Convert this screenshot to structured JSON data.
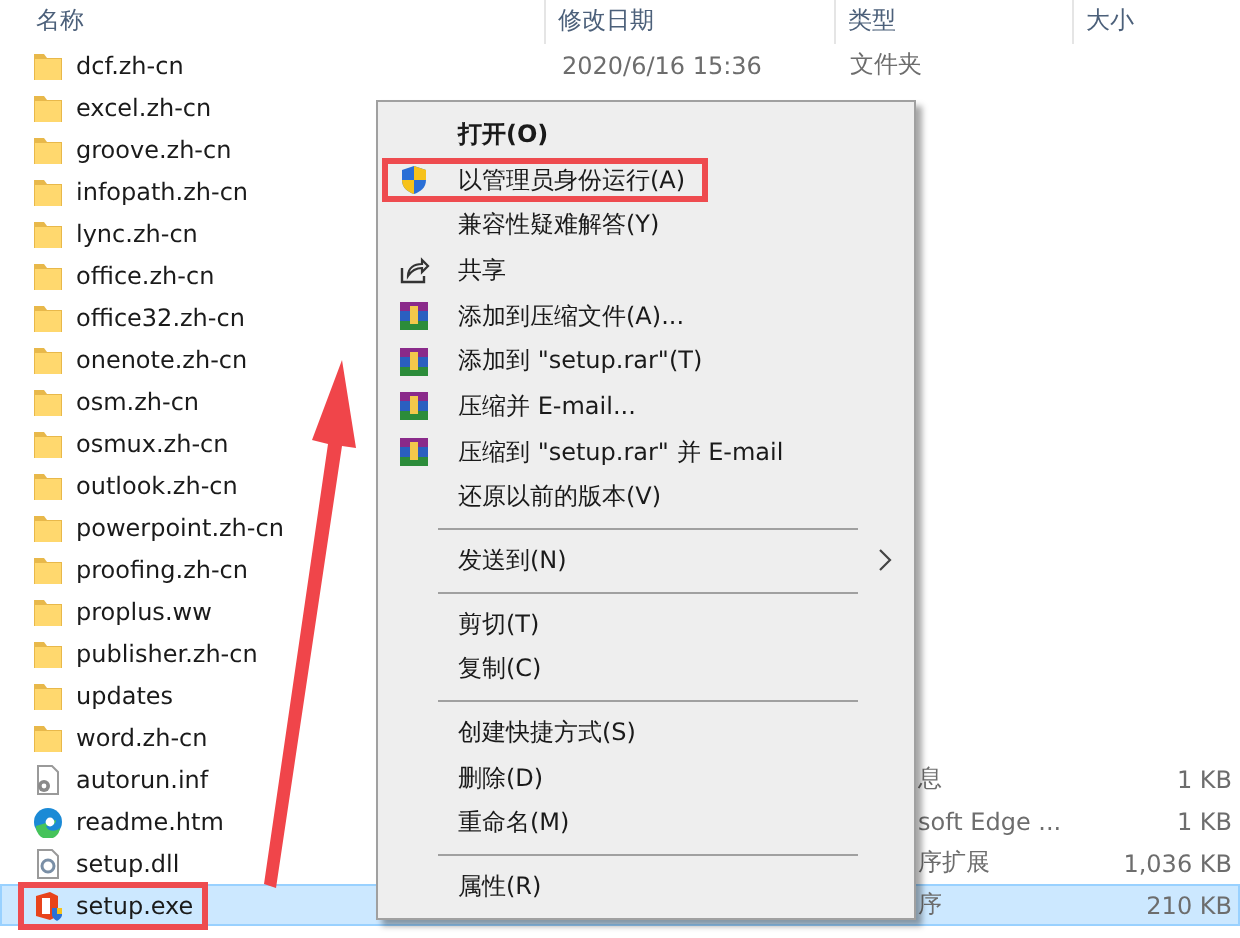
{
  "columns": [
    "名称",
    "修改日期",
    "类型",
    "大小"
  ],
  "files": [
    {
      "name": "dcf.zh-cn",
      "kind": "folder",
      "date": "2020/6/16 15:36",
      "type": "文件夹",
      "selected": false
    },
    {
      "name": "excel.zh-cn",
      "kind": "folder",
      "selected": false
    },
    {
      "name": "groove.zh-cn",
      "kind": "folder",
      "selected": false
    },
    {
      "name": "infopath.zh-cn",
      "kind": "folder",
      "selected": false
    },
    {
      "name": "lync.zh-cn",
      "kind": "folder",
      "selected": false
    },
    {
      "name": "office.zh-cn",
      "kind": "folder",
      "selected": false
    },
    {
      "name": "office32.zh-cn",
      "kind": "folder",
      "selected": false
    },
    {
      "name": "onenote.zh-cn",
      "kind": "folder",
      "selected": false
    },
    {
      "name": "osm.zh-cn",
      "kind": "folder",
      "selected": false
    },
    {
      "name": "osmux.zh-cn",
      "kind": "folder",
      "selected": false
    },
    {
      "name": "outlook.zh-cn",
      "kind": "folder",
      "selected": false
    },
    {
      "name": "powerpoint.zh-cn",
      "kind": "folder",
      "selected": false
    },
    {
      "name": "proofing.zh-cn",
      "kind": "folder",
      "selected": false
    },
    {
      "name": "proplus.ww",
      "kind": "folder",
      "selected": false
    },
    {
      "name": "publisher.zh-cn",
      "kind": "folder",
      "selected": false
    },
    {
      "name": "updates",
      "kind": "folder",
      "selected": false
    },
    {
      "name": "word.zh-cn",
      "kind": "folder",
      "selected": false
    },
    {
      "name": "autorun.inf",
      "kind": "settings",
      "type": "息",
      "type_cut": true,
      "size": "1 KB",
      "selected": false
    },
    {
      "name": "readme.htm",
      "kind": "edge",
      "type": "soft Edge ...",
      "type_cut": true,
      "size": "1 KB",
      "selected": false
    },
    {
      "name": "setup.dll",
      "kind": "dll",
      "type": "序扩展",
      "type_cut": true,
      "size": "1,036 KB",
      "selected": false
    },
    {
      "name": "setup.exe",
      "kind": "office",
      "type": "序",
      "type_cut": true,
      "size": "210 KB",
      "selected": true,
      "annotated": true
    }
  ],
  "context_menu": {
    "items": [
      {
        "kind": "item",
        "label": "打开(O)",
        "bold": true
      },
      {
        "kind": "shield",
        "label": "以管理员身份运行(A)",
        "annotated": true
      },
      {
        "kind": "item",
        "label": "兼容性疑难解答(Y)"
      },
      {
        "kind": "share",
        "label": "共享"
      },
      {
        "kind": "archive",
        "label": "添加到压缩文件(A)..."
      },
      {
        "kind": "archive",
        "label": "添加到 \"setup.rar\"(T)"
      },
      {
        "kind": "archive",
        "label": "压缩并 E-mail..."
      },
      {
        "kind": "archive",
        "label": "压缩到 \"setup.rar\" 并 E-mail"
      },
      {
        "kind": "item",
        "label": "还原以前的版本(V)"
      },
      {
        "kind": "separator"
      },
      {
        "kind": "item",
        "label": "发送到(N)",
        "submenu": true
      },
      {
        "kind": "separator"
      },
      {
        "kind": "item",
        "label": "剪切(T)"
      },
      {
        "kind": "item",
        "label": "复制(C)"
      },
      {
        "kind": "separator"
      },
      {
        "kind": "item",
        "label": "创建快捷方式(S)"
      },
      {
        "kind": "item",
        "label": "删除(D)"
      },
      {
        "kind": "item",
        "label": "重命名(M)"
      },
      {
        "kind": "separator"
      },
      {
        "kind": "item",
        "label": "属性(R)"
      }
    ]
  }
}
